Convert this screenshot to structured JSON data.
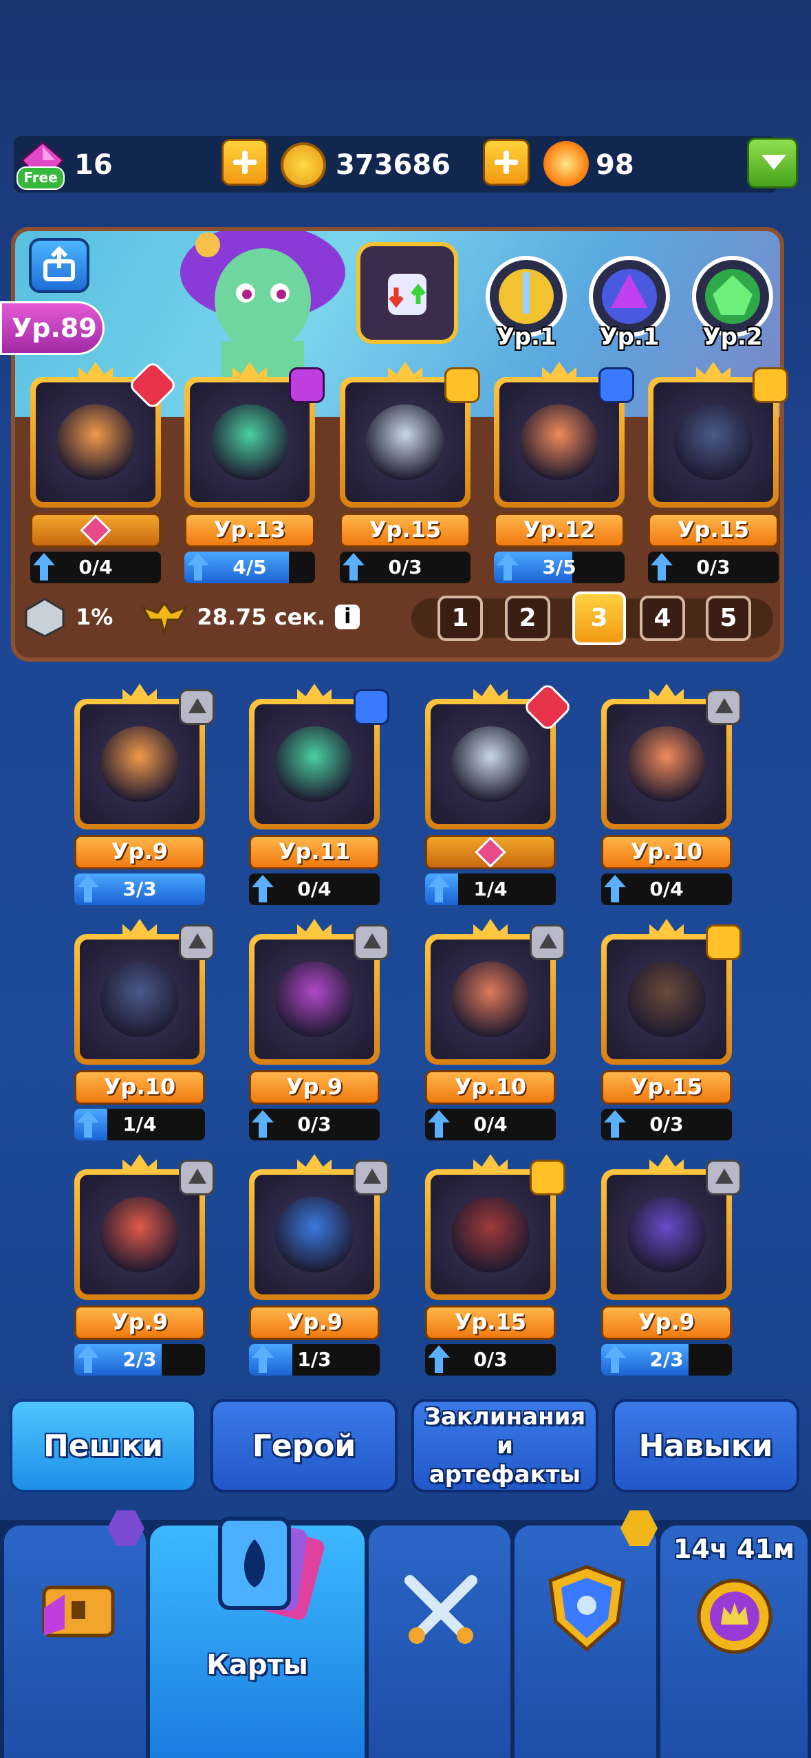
{
  "currencies": {
    "gems": "16",
    "gems_badge": "Free",
    "coins": "373686",
    "energy": "98"
  },
  "profile": {
    "level": "Ур.89"
  },
  "skills": [
    {
      "level": "Ур.1",
      "icon": "sword-icon"
    },
    {
      "level": "Ур.1",
      "icon": "wizard-icon"
    },
    {
      "level": "Ур.2",
      "icon": "helmet-icon"
    }
  ],
  "deck": [
    {
      "level": "",
      "progress": "0/4",
      "fill": 0,
      "corner": "roman-one"
    },
    {
      "level": "Ур.13",
      "progress": "4/5",
      "fill": 0.8,
      "corner": "purple"
    },
    {
      "level": "Ур.15",
      "progress": "0/3",
      "fill": 0,
      "corner": "crown"
    },
    {
      "level": "Ур.12",
      "progress": "3/5",
      "fill": 0.6,
      "corner": "blue"
    },
    {
      "level": "Ур.15",
      "progress": "0/3",
      "fill": 0,
      "corner": "crown"
    }
  ],
  "stats": {
    "crit": "1%",
    "time": "28.75 сек."
  },
  "pages": [
    "1",
    "2",
    "3",
    "4",
    "5"
  ],
  "active_page": 3,
  "collection": [
    {
      "level": "Ур.9",
      "progress": "3/3",
      "fill": 1,
      "corner": "tri"
    },
    {
      "level": "Ур.11",
      "progress": "0/4",
      "fill": 0,
      "corner": "blue"
    },
    {
      "level": "",
      "progress": "1/4",
      "fill": 0.25,
      "corner": "roman-one"
    },
    {
      "level": "Ур.10",
      "progress": "0/4",
      "fill": 0,
      "corner": "tri"
    },
    {
      "level": "Ур.10",
      "progress": "1/4",
      "fill": 0.25,
      "corner": "tri"
    },
    {
      "level": "Ур.9",
      "progress": "0/3",
      "fill": 0,
      "corner": "tri"
    },
    {
      "level": "Ур.10",
      "progress": "0/4",
      "fill": 0,
      "corner": "tri"
    },
    {
      "level": "Ур.15",
      "progress": "0/3",
      "fill": 0,
      "corner": "crown"
    },
    {
      "level": "Ур.9",
      "progress": "2/3",
      "fill": 0.67,
      "corner": "tri"
    },
    {
      "level": "Ур.9",
      "progress": "1/3",
      "fill": 0.33,
      "corner": "tri"
    },
    {
      "level": "Ур.15",
      "progress": "0/3",
      "fill": 0,
      "corner": "crown"
    },
    {
      "level": "Ур.9",
      "progress": "2/3",
      "fill": 0.67,
      "corner": "tri"
    }
  ],
  "tabs": [
    "Пешки",
    "Герой",
    "Заклинания и артефакты",
    "Навыки"
  ],
  "nav": {
    "cards_label": "Карты",
    "timer": "14ч 41м"
  }
}
